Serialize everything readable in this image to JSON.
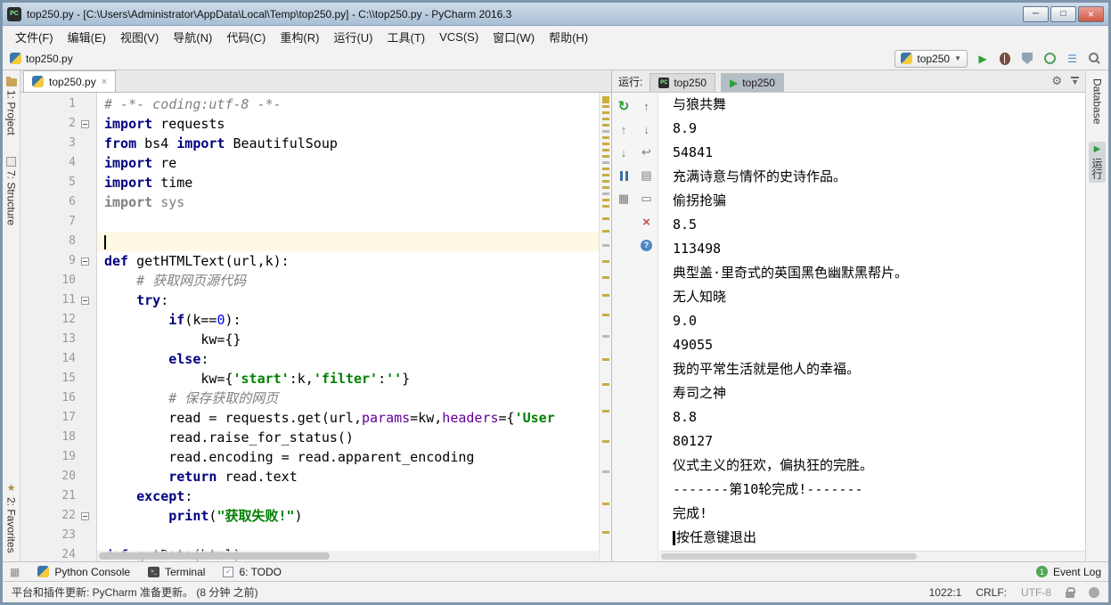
{
  "window": {
    "title": "top250.py - [C:\\Users\\Administrator\\AppData\\Local\\Temp\\top250.py] - C:\\\\top250.py - PyCharm 2016.3",
    "minimize": "─",
    "maximize": "□",
    "close": "×"
  },
  "menu": {
    "items": [
      "文件(F)",
      "编辑(E)",
      "视图(V)",
      "导航(N)",
      "代码(C)",
      "重构(R)",
      "运行(U)",
      "工具(T)",
      "VCS(S)",
      "窗口(W)",
      "帮助(H)"
    ]
  },
  "navbar": {
    "breadcrumb": "top250.py",
    "run_config": "top250"
  },
  "left_stripe": {
    "project": "1: Project",
    "structure": "7: Structure",
    "favorites": "2: Favorites"
  },
  "right_stripe": {
    "database": "Database",
    "run": "运行"
  },
  "editor": {
    "tab": "top250.py",
    "tab_close": "×",
    "caret_line": 8,
    "folds": [
      2,
      9,
      11,
      22
    ],
    "lines": [
      [
        [
          "c",
          "# -*- coding:utf-8 -*-"
        ]
      ],
      [
        [
          "k",
          "import"
        ],
        [
          "t",
          " requests"
        ]
      ],
      [
        [
          "k",
          "from"
        ],
        [
          "t",
          " bs4 "
        ],
        [
          "k",
          "import"
        ],
        [
          "t",
          " BeautifulSoup"
        ]
      ],
      [
        [
          "k",
          "import"
        ],
        [
          "t",
          " re"
        ]
      ],
      [
        [
          "k",
          "import"
        ],
        [
          "t",
          " time"
        ]
      ],
      [
        [
          "gk",
          "import"
        ],
        [
          "g",
          " sys"
        ]
      ],
      [],
      [],
      [
        [
          "k",
          "def"
        ],
        [
          "t",
          " getHTMLText(url,k):"
        ]
      ],
      [
        [
          "t",
          "    "
        ],
        [
          "c",
          "# 获取网页源代码"
        ]
      ],
      [
        [
          "t",
          "    "
        ],
        [
          "k",
          "try"
        ],
        [
          "t",
          ":"
        ]
      ],
      [
        [
          "t",
          "        "
        ],
        [
          "k",
          "if"
        ],
        [
          "t",
          "(k=="
        ],
        [
          "n",
          "0"
        ],
        [
          "t",
          "):"
        ]
      ],
      [
        [
          "t",
          "            kw={}"
        ]
      ],
      [
        [
          "t",
          "        "
        ],
        [
          "k",
          "else"
        ],
        [
          "t",
          ":"
        ]
      ],
      [
        [
          "t",
          "            kw={"
        ],
        [
          "s",
          "'start'"
        ],
        [
          "t",
          ":k,"
        ],
        [
          "s",
          "'filter'"
        ],
        [
          "t",
          ":"
        ],
        [
          "s",
          "''"
        ],
        [
          "t",
          "}"
        ]
      ],
      [
        [
          "t",
          "        "
        ],
        [
          "c",
          "# 保存获取的网页"
        ]
      ],
      [
        [
          "t",
          "        read = requests.get(url,"
        ],
        [
          "p",
          "params"
        ],
        [
          "t",
          "=kw,"
        ],
        [
          "p",
          "headers"
        ],
        [
          "t",
          "={"
        ],
        [
          "s",
          "'User"
        ]
      ],
      [
        [
          "t",
          "        read.raise_for_status()"
        ]
      ],
      [
        [
          "t",
          "        read.encoding = read.apparent_encoding"
        ]
      ],
      [
        [
          "t",
          "        "
        ],
        [
          "k",
          "return"
        ],
        [
          "t",
          " read.text"
        ]
      ],
      [
        [
          "t",
          "    "
        ],
        [
          "k",
          "except"
        ],
        [
          "t",
          ":"
        ]
      ],
      [
        [
          "t",
          "        "
        ],
        [
          "k",
          "print"
        ],
        [
          "t",
          "("
        ],
        [
          "s",
          "\"获取失败!\""
        ],
        [
          "t",
          ")"
        ]
      ],
      [],
      [
        [
          "k",
          "def"
        ],
        [
          "t",
          " getData(html):"
        ]
      ]
    ]
  },
  "run_panel": {
    "label": "运行:",
    "tab1": "top250",
    "tab2": "top250",
    "output": [
      "与狼共舞",
      "8.9",
      "54841",
      "充满诗意与情怀的史诗作品。",
      "偷拐抢骗",
      "8.5",
      "113498",
      "典型盖·里奇式的英国黑色幽默黑帮片。",
      "无人知晓",
      "9.0",
      "49055",
      "我的平常生活就是他人的幸福。",
      "寿司之神",
      "8.8",
      "80127",
      "仪式主义的狂欢，偏执狂的完胜。",
      "-------第10轮完成!-------",
      "完成!",
      "按任意键退出"
    ]
  },
  "bottom_bar": {
    "python_console": "Python Console",
    "terminal": "Terminal",
    "todo": "6: TODO",
    "event_count": "1",
    "event_log": "Event Log"
  },
  "status_bar": {
    "message": "平台和插件更新: PyCharm 准备更新。  (8 分钟 之前)",
    "position": "1022:1",
    "line_sep": "CRLF:",
    "encoding": "UTF-8"
  },
  "colors": {
    "keyword": "#000080",
    "string": "#008000",
    "comment": "#808080",
    "number": "#0000ff",
    "param": "#660099",
    "caret_row": "#fdf9e3",
    "run_green": "#2f9e39",
    "mark_yellow": "#c9ac42"
  }
}
